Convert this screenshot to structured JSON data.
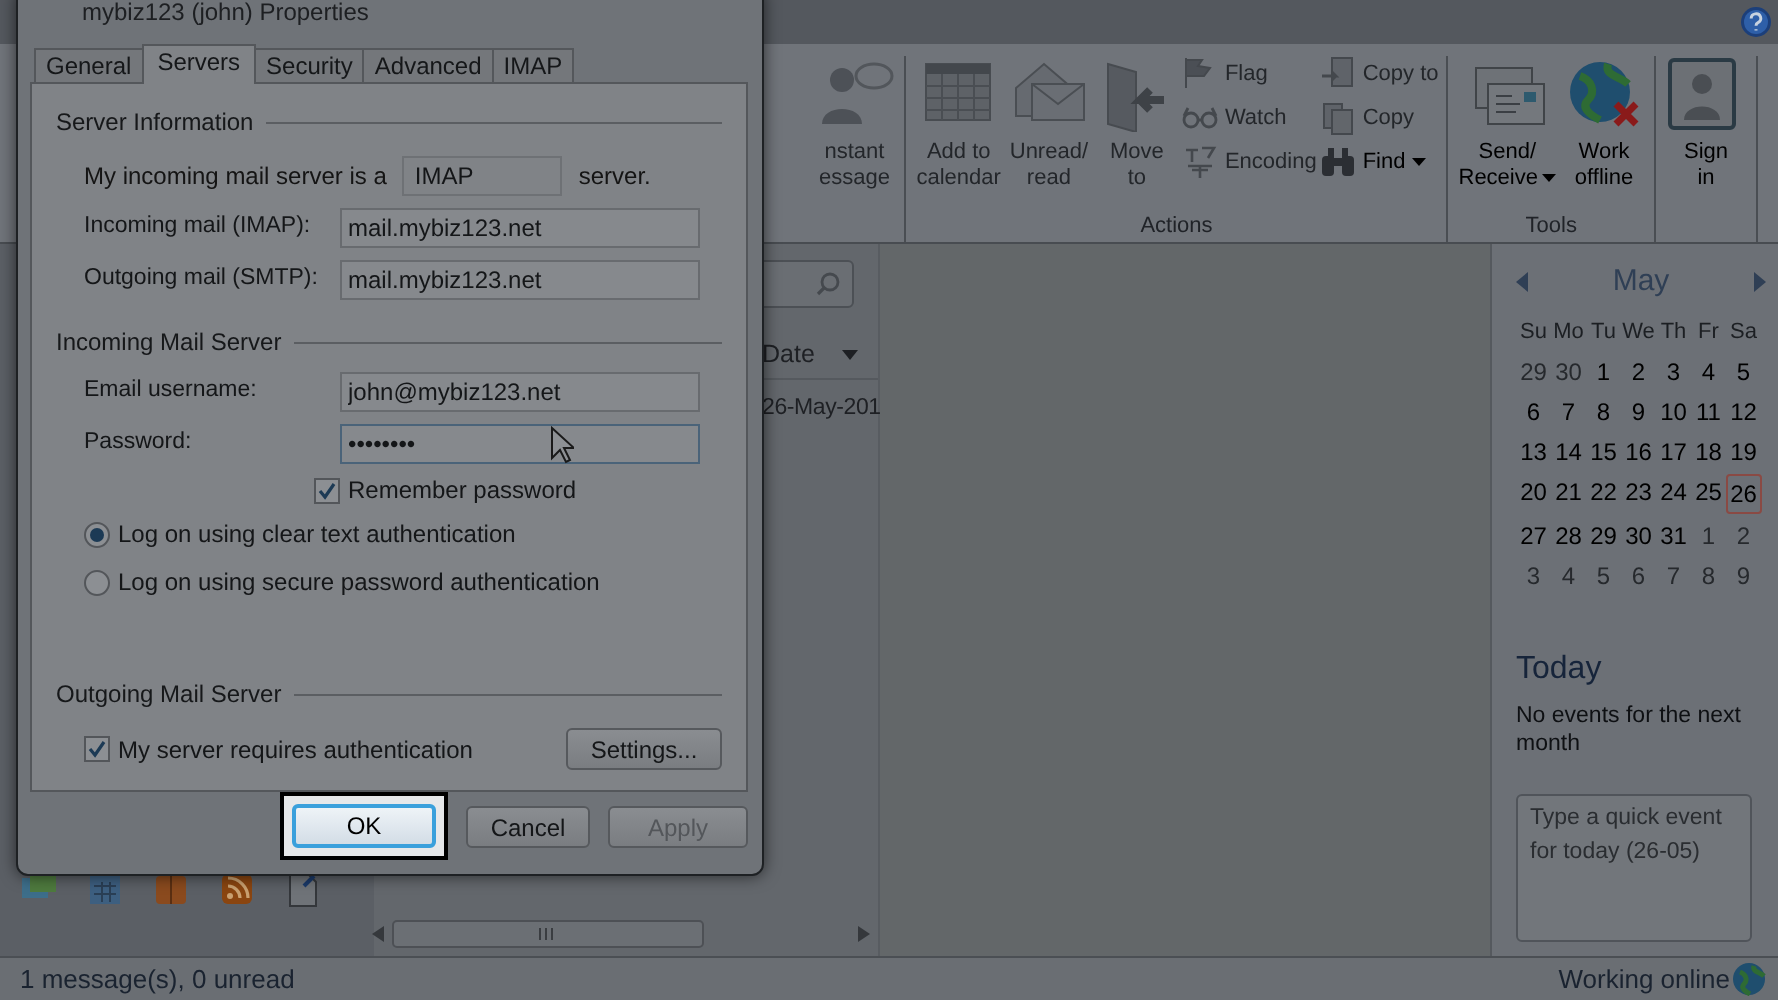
{
  "ribbon": {
    "groups": [
      {
        "items": [
          {
            "kind": "large",
            "label": "nstant\nessage",
            "disabled": true
          }
        ]
      },
      {
        "label": "Actions",
        "items": [
          {
            "kind": "large",
            "label": "Add to\ncalendar",
            "disabled": true
          },
          {
            "kind": "large",
            "label": "Unread/\nread",
            "disabled": true
          },
          {
            "kind": "large",
            "label": "Move\nto",
            "disabled": true
          },
          {
            "kind": "stack",
            "items": [
              {
                "label": "Flag",
                "disabled": true
              },
              {
                "label": "Watch",
                "disabled": true
              },
              {
                "label": "Encoding",
                "disabled": true
              }
            ]
          },
          {
            "kind": "stack",
            "items": [
              {
                "label": "Copy to",
                "disabled": true
              },
              {
                "label": "Copy",
                "disabled": true
              },
              {
                "label": "Find",
                "disabled": false,
                "dropdown": true
              }
            ]
          }
        ]
      },
      {
        "label": "Tools",
        "items": [
          {
            "kind": "large",
            "label": "Send/\nReceive",
            "disabled": false,
            "dropdown": true
          },
          {
            "kind": "large",
            "label": "Work\noffline",
            "disabled": false
          }
        ]
      },
      {
        "items": [
          {
            "kind": "large",
            "label": "Sign\nin",
            "disabled": false
          }
        ]
      }
    ]
  },
  "message_list": {
    "columns": [
      {
        "label": "Date",
        "sorted": true
      }
    ],
    "rows": [
      [
        "26-May-201"
      ]
    ]
  },
  "calendar": {
    "month": "May",
    "weekdays": [
      "Su",
      "Mo",
      "Tu",
      "We",
      "Th",
      "Fr",
      "Sa"
    ],
    "weeks": [
      [
        {
          "day": "29",
          "in_month": false,
          "selected": false
        },
        {
          "day": "30",
          "in_month": false,
          "selected": false
        },
        {
          "day": "1",
          "in_month": true,
          "selected": false
        },
        {
          "day": "2",
          "in_month": true,
          "selected": false
        },
        {
          "day": "3",
          "in_month": true,
          "selected": false
        },
        {
          "day": "4",
          "in_month": true,
          "selected": false
        },
        {
          "day": "5",
          "in_month": true,
          "selected": false
        }
      ],
      [
        {
          "day": "6",
          "in_month": true,
          "selected": false
        },
        {
          "day": "7",
          "in_month": true,
          "selected": false
        },
        {
          "day": "8",
          "in_month": true,
          "selected": false
        },
        {
          "day": "9",
          "in_month": true,
          "selected": false
        },
        {
          "day": "10",
          "in_month": true,
          "selected": false
        },
        {
          "day": "11",
          "in_month": true,
          "selected": false
        },
        {
          "day": "12",
          "in_month": true,
          "selected": false
        }
      ],
      [
        {
          "day": "13",
          "in_month": true,
          "selected": false
        },
        {
          "day": "14",
          "in_month": true,
          "selected": false
        },
        {
          "day": "15",
          "in_month": true,
          "selected": false
        },
        {
          "day": "16",
          "in_month": true,
          "selected": false
        },
        {
          "day": "17",
          "in_month": true,
          "selected": false
        },
        {
          "day": "18",
          "in_month": true,
          "selected": false
        },
        {
          "day": "19",
          "in_month": true,
          "selected": false
        }
      ],
      [
        {
          "day": "20",
          "in_month": true,
          "selected": false
        },
        {
          "day": "21",
          "in_month": true,
          "selected": false
        },
        {
          "day": "22",
          "in_month": true,
          "selected": false
        },
        {
          "day": "23",
          "in_month": true,
          "selected": false
        },
        {
          "day": "24",
          "in_month": true,
          "selected": false
        },
        {
          "day": "25",
          "in_month": true,
          "selected": false
        },
        {
          "day": "26",
          "in_month": true,
          "selected": true
        }
      ],
      [
        {
          "day": "27",
          "in_month": true,
          "selected": false
        },
        {
          "day": "28",
          "in_month": true,
          "selected": false
        },
        {
          "day": "29",
          "in_month": true,
          "selected": false
        },
        {
          "day": "30",
          "in_month": true,
          "selected": false
        },
        {
          "day": "31",
          "in_month": true,
          "selected": false
        },
        {
          "day": "1",
          "in_month": false,
          "selected": false
        },
        {
          "day": "2",
          "in_month": false,
          "selected": false
        }
      ],
      [
        {
          "day": "3",
          "in_month": false,
          "selected": false
        },
        {
          "day": "4",
          "in_month": false,
          "selected": false
        },
        {
          "day": "5",
          "in_month": false,
          "selected": false
        },
        {
          "day": "6",
          "in_month": false,
          "selected": false
        },
        {
          "day": "7",
          "in_month": false,
          "selected": false
        },
        {
          "day": "8",
          "in_month": false,
          "selected": false
        },
        {
          "day": "9",
          "in_month": false,
          "selected": false
        }
      ]
    ]
  },
  "today": {
    "heading": "Today",
    "message": "No events for the next month",
    "quick_event_placeholder": "Type a quick event for today (26-05)"
  },
  "status_bar": {
    "left": "1 message(s), 0 unread",
    "right": "Working online"
  },
  "dialog": {
    "title": "mybiz123 (john) Properties",
    "tabs": [
      {
        "label": "General",
        "selected": false
      },
      {
        "label": "Servers",
        "selected": true
      },
      {
        "label": "Security",
        "selected": false
      },
      {
        "label": "Advanced",
        "selected": false
      },
      {
        "label": "IMAP",
        "selected": false
      }
    ],
    "server_information": {
      "heading": "Server Information",
      "type_prefix": "My incoming mail server is a",
      "type_value": "IMAP",
      "type_suffix": "server.",
      "fields": [
        {
          "label": "Incoming mail (IMAP):",
          "value": "mail.mybiz123.net",
          "focused": false
        },
        {
          "label": "Outgoing mail (SMTP):",
          "value": "mail.mybiz123.net",
          "focused": false
        }
      ]
    },
    "incoming_mail_server": {
      "heading": "Incoming Mail Server",
      "fields": [
        {
          "label": "Email username:",
          "value": "john@mybiz123.net",
          "focused": false
        },
        {
          "label": "Password:",
          "value": "••••••••",
          "focused": true
        }
      ],
      "remember_password": {
        "label": "Remember password",
        "checked": true
      },
      "logon_options": [
        {
          "label": "Log on using clear text authentication",
          "selected": true
        },
        {
          "label": "Log on using secure password authentication",
          "selected": false
        }
      ]
    },
    "outgoing_mail_server": {
      "heading": "Outgoing Mail Server",
      "requires_auth": {
        "label": "My server requires authentication",
        "checked": true
      },
      "settings_button": "Settings..."
    },
    "buttons": [
      {
        "label": "OK",
        "highlighted": true,
        "disabled": false
      },
      {
        "label": "Cancel",
        "highlighted": false,
        "disabled": false
      },
      {
        "label": "Apply",
        "highlighted": false,
        "disabled": true
      }
    ]
  }
}
